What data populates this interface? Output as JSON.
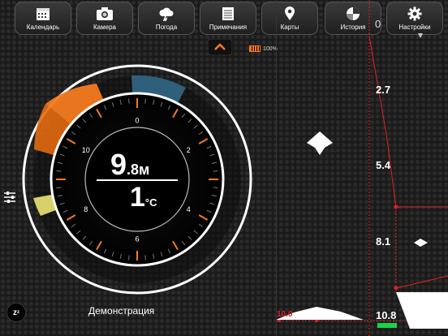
{
  "toolbar": {
    "tabs": [
      {
        "label": "Календарь",
        "icon": "calendar-icon"
      },
      {
        "label": "Камера",
        "icon": "camera-icon"
      },
      {
        "label": "Погода",
        "icon": "weather-icon"
      },
      {
        "label": "Примечания",
        "icon": "notes-icon"
      },
      {
        "label": "Карты",
        "icon": "map-pin-icon"
      },
      {
        "label": "История",
        "icon": "history-icon"
      },
      {
        "label": "Настройки",
        "icon": "gear-icon"
      }
    ]
  },
  "status": {
    "battery": "100%",
    "corner_value": "0"
  },
  "gauge": {
    "depth_value": "9",
    "depth_unit": ".8м",
    "temp_value": "1",
    "temp_unit": "°C",
    "dial_labels": [
      "0",
      "2",
      "4",
      "6",
      "8",
      "10"
    ]
  },
  "sonar": {
    "scale": [
      "2.7",
      "5.4",
      "8.1"
    ],
    "bottom_depth": "10.8",
    "bottom_label": "10.0"
  },
  "footer": {
    "mode_label": "Демонстрация",
    "sleep_label": "z"
  },
  "colors": {
    "accent": "#f47a20",
    "alert": "#e31f26",
    "ok": "#19d34a",
    "cold": "#2f5f7a"
  }
}
